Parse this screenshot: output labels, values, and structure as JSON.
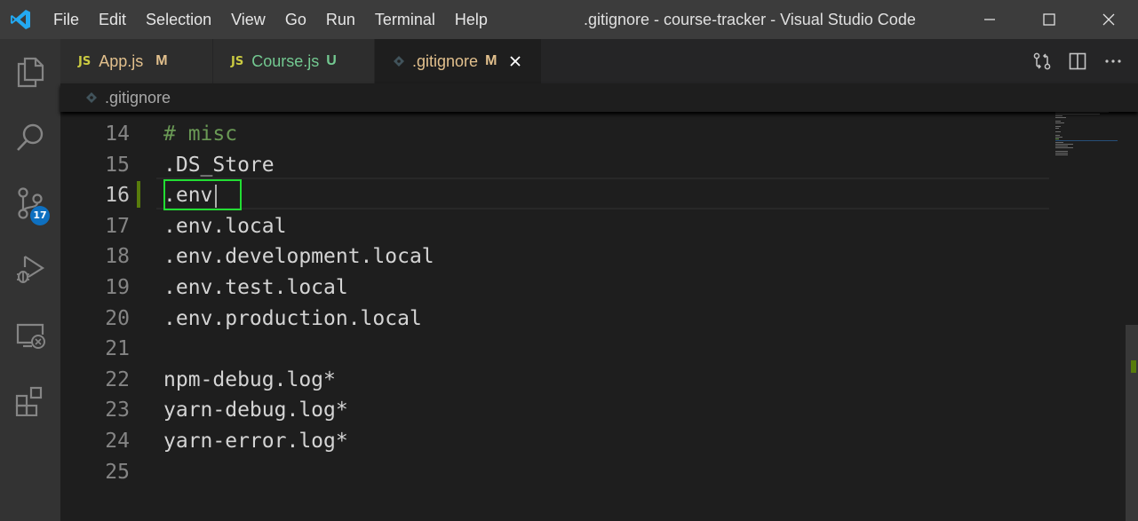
{
  "titlebar": {
    "menu": [
      "File",
      "Edit",
      "Selection",
      "View",
      "Go",
      "Run",
      "Terminal",
      "Help"
    ],
    "window_title": ".gitignore - course-tracker - Visual Studio Code",
    "controls": [
      "minimize-icon",
      "maximize-icon",
      "close-icon"
    ]
  },
  "activitybar": {
    "items": [
      {
        "name": "explorer",
        "icon": "files-icon"
      },
      {
        "name": "search",
        "icon": "search-icon"
      },
      {
        "name": "source-control",
        "icon": "source-control-icon",
        "badge": "17"
      },
      {
        "name": "run-debug",
        "icon": "run-debug-icon"
      },
      {
        "name": "remote-explorer",
        "icon": "remote-explorer-icon"
      },
      {
        "name": "extensions",
        "icon": "extensions-icon"
      }
    ]
  },
  "tabs": [
    {
      "prefix": "JS",
      "label": "App.js",
      "status": "M",
      "label_color": "#e2c08d",
      "status_color": "#e2c08d",
      "active": false
    },
    {
      "prefix": "JS",
      "label": "Course.js",
      "status": "U",
      "label_color": "#73c991",
      "status_color": "#73c991",
      "active": false
    },
    {
      "prefix": "gear",
      "label": ".gitignore",
      "status": "M",
      "label_color": "#e2c08d",
      "status_color": "#e2c08d",
      "active": true
    }
  ],
  "editor_actions": [
    "open-changes-icon",
    "split-editor-icon",
    "more-actions-icon"
  ],
  "breadcrumb": {
    "file": ".gitignore"
  },
  "editor": {
    "lines": [
      {
        "number": "14",
        "text": "# misc",
        "comment": true
      },
      {
        "number": "15",
        "text": ".DS_Store",
        "comment": false
      },
      {
        "number": "16",
        "text": ".env",
        "comment": false,
        "current": true
      },
      {
        "number": "17",
        "text": ".env.local",
        "comment": false
      },
      {
        "number": "18",
        "text": ".env.development.local",
        "comment": false
      },
      {
        "number": "19",
        "text": ".env.test.local",
        "comment": false
      },
      {
        "number": "20",
        "text": ".env.production.local",
        "comment": false
      },
      {
        "number": "21",
        "text": "",
        "comment": false
      },
      {
        "number": "22",
        "text": "npm-debug.log*",
        "comment": false
      },
      {
        "number": "23",
        "text": "yarn-debug.log*",
        "comment": false
      },
      {
        "number": "24",
        "text": "yarn-error.log*",
        "comment": false
      },
      {
        "number": "25",
        "text": "",
        "comment": false
      }
    ]
  },
  "colors": {
    "accent": "#0e70c0",
    "comment": "#6a9955",
    "modified_gutter": "#587c0c",
    "highlight_box": "#22dd33"
  }
}
